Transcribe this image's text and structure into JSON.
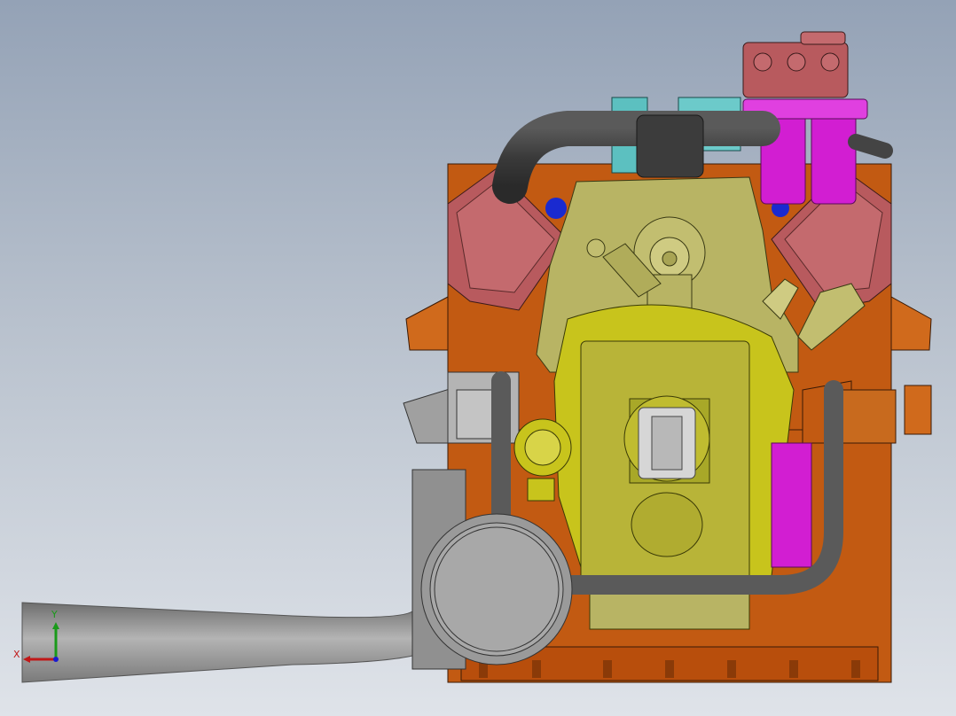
{
  "viewport": {
    "background_top": "#94a2b6",
    "background_bottom": "#dfe3e9"
  },
  "model": {
    "subject": "v-engine-assembly-front-view",
    "colors": {
      "base_frame": "#c25a12",
      "cylinder_heads": "#b85a5e",
      "timing_cover": "#b8b464",
      "gearbox": "#c8c41c",
      "oil_filters": "#d21ed2",
      "hoses": "#4a4a4a",
      "exhaust": "#8e8e8e",
      "top_fittings": "#5cc0c0",
      "blue_parts": "#1a2ad0"
    }
  },
  "triad": {
    "x_label": "X",
    "y_label": "Y",
    "x_color": "#c01818",
    "y_color": "#1a9a1a",
    "z_color": "#1a1ad0"
  }
}
